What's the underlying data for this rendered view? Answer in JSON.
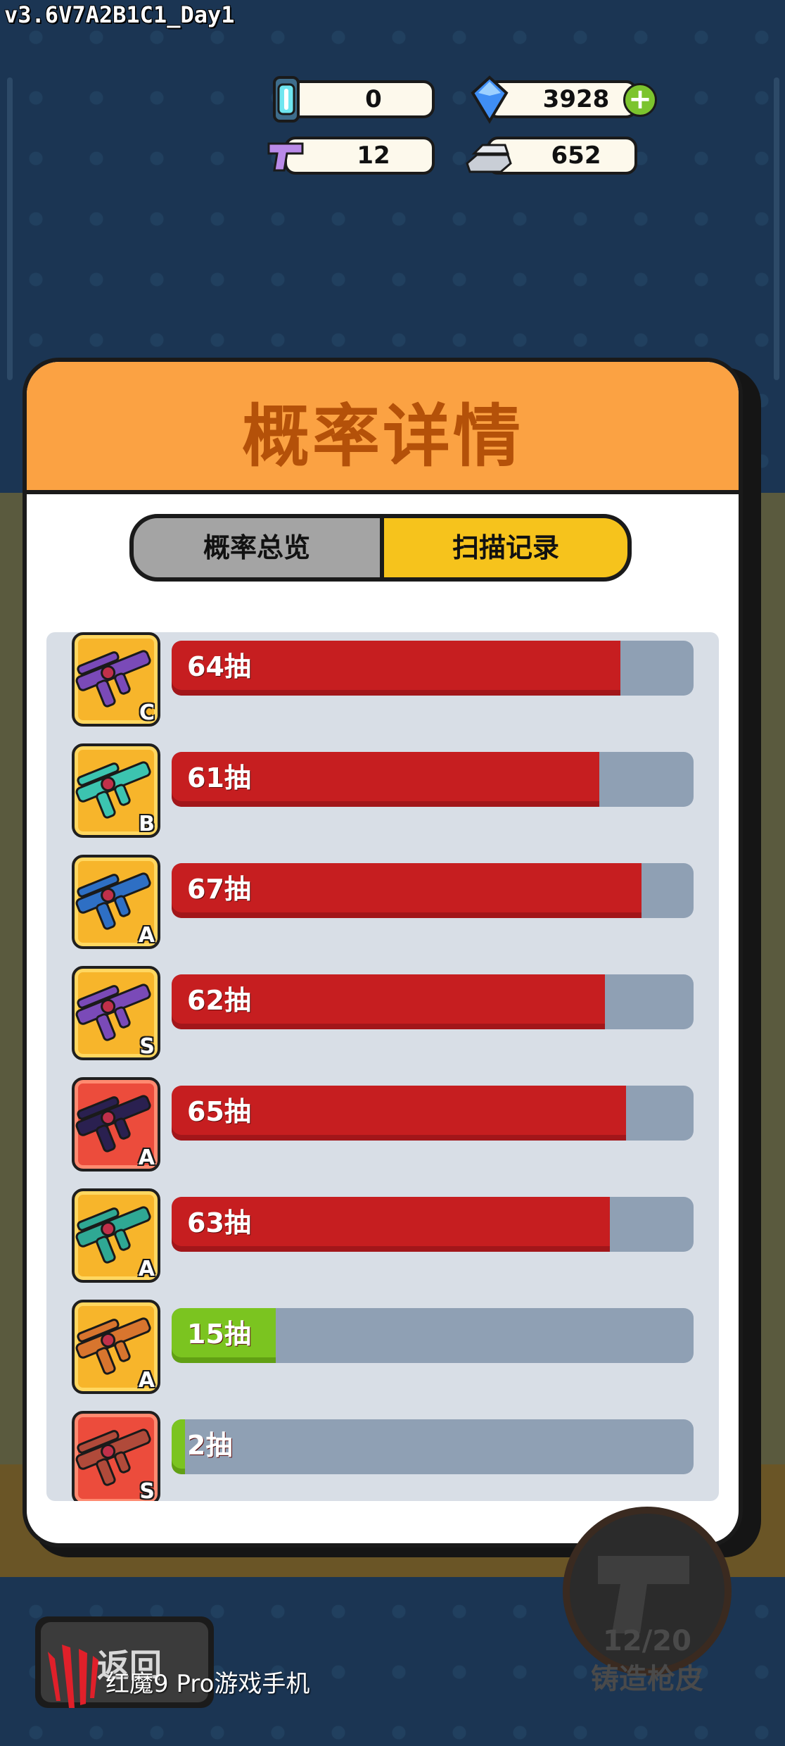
{
  "version": "v3.6V7A2B1C1_Day1",
  "resources": [
    {
      "name": "capsule",
      "value": "0"
    },
    {
      "name": "gem",
      "value": "3928"
    },
    {
      "name": "gun-skin",
      "value": "12"
    },
    {
      "name": "silver",
      "value": "652"
    }
  ],
  "colors": {
    "accent_orange": "#fba243",
    "title_brown": "#b45109",
    "tab_active": "#f6c31c",
    "bar_red": "#c61e20",
    "bar_green": "#7bc420"
  },
  "panel": {
    "title": "概率详情",
    "tabs": [
      {
        "label": "概率总览",
        "active": false
      },
      {
        "label": "扫描记录",
        "active": true
      }
    ]
  },
  "records": [
    {
      "grade": "C",
      "label": "64抽",
      "progress": 0.86,
      "bar": "red",
      "card": "gold",
      "gun": "#7a4ab8"
    },
    {
      "grade": "B",
      "label": "61抽",
      "progress": 0.82,
      "bar": "red",
      "card": "gold",
      "gun": "#3cc4b0"
    },
    {
      "grade": "A",
      "label": "67抽",
      "progress": 0.9,
      "bar": "red",
      "card": "gold",
      "gun": "#2e6fc4"
    },
    {
      "grade": "S",
      "label": "62抽",
      "progress": 0.83,
      "bar": "red",
      "card": "gold",
      "gun": "#7a4ab8"
    },
    {
      "grade": "A",
      "label": "65抽",
      "progress": 0.87,
      "bar": "red",
      "card": "red",
      "gun": "#2a2050"
    },
    {
      "grade": "A",
      "label": "63抽",
      "progress": 0.84,
      "bar": "red",
      "card": "gold",
      "gun": "#2fa894"
    },
    {
      "grade": "A",
      "label": "15抽",
      "progress": 0.2,
      "bar": "green",
      "card": "gold",
      "gun": "#d8752e"
    },
    {
      "grade": "S",
      "label": "2抽",
      "progress": 0.025,
      "bar": "green",
      "card": "red",
      "gun": "#b04a3a"
    }
  ],
  "bottom": {
    "back_label": "返回",
    "forge_count": "12/20",
    "forge_label": "铸造枪皮",
    "watermark": "红魔9 Pro游戏手机"
  }
}
